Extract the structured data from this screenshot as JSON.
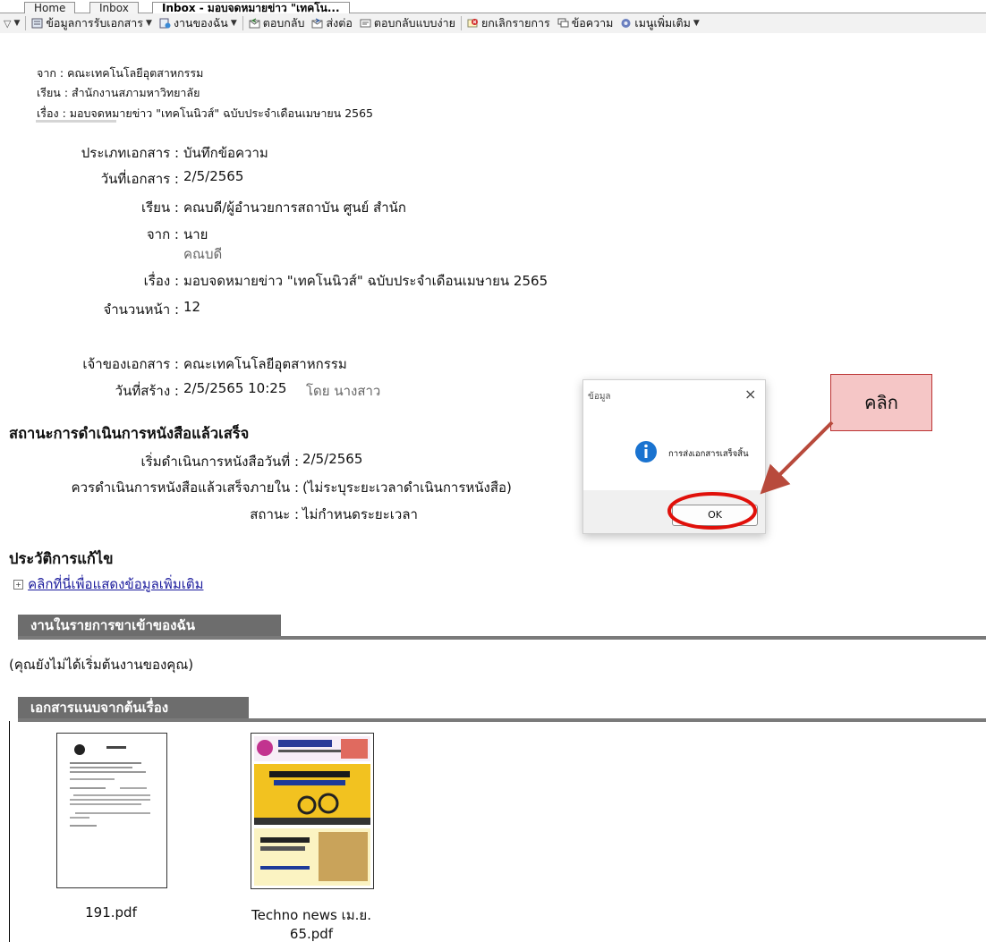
{
  "tabs": [
    {
      "label": "Home"
    },
    {
      "label": "Inbox"
    },
    {
      "label": "Inbox - มอบจดหมายข่าว \"เทคโน..."
    }
  ],
  "toolbar": {
    "doc_info": "ข้อมูลการรับเอกสาร",
    "my_work": "งานของฉัน",
    "reply": "ตอบกลับ",
    "forward": "ส่งต่อ",
    "simple_reply": "ตอบกลับแบบง่าย",
    "cancel_item": "ยกเลิกรายการ",
    "message": "ข้อความ",
    "more_menu": "เมนูเพิ่มเติม"
  },
  "header": {
    "from": "จาก : คณะเทคโนโลยีอุตสาหกรรม",
    "to": "เรียน : สำนักงานสภามหาวิทยาลัย",
    "subject": "เรื่อง : มอบจดหมายข่าว \"เทคโนนิวส์\" ฉบับประจำเดือนเมษายน 2565"
  },
  "doc": {
    "type_label": "ประเภทเอกสาร :",
    "type_value": "บันทึกข้อความ",
    "date_label": "วันที่เอกสาร :",
    "date_value": "2/5/2565",
    "to_label": "เรียน :",
    "to_value": "คณบดี/ผู้อำนวยการสถาบัน ศูนย์ สำนัก",
    "from_label": "จาก :",
    "from_value": "นาย",
    "from_sub": "คณบดี",
    "subject_label": "เรื่อง :",
    "subject_value": "มอบจดหมายข่าว \"เทคโนนิวส์\" ฉบับประจำเดือนเมษายน 2565",
    "pages_label": "จำนวนหน้า :",
    "pages_value": "12",
    "owner_label": "เจ้าของเอกสาร :",
    "owner_value": "คณะเทคโนโลยีอุตสาหกรรม",
    "created_label": "วันที่สร้าง :",
    "created_value": "2/5/2565 10:25",
    "created_by": "โดย นางสาว"
  },
  "status": {
    "title": "สถานะการดำเนินการหนังสือแล้วเสร็จ",
    "start_label": "เริ่มดำเนินการหนังสือวันที่ :",
    "start_value": "2/5/2565",
    "due_label": "ควรดำเนินการหนังสือแล้วเสร็จภายใน :",
    "due_value": "(ไม่ระบุระยะเวลาดำเนินการหนังสือ)",
    "state_label": "สถานะ :",
    "state_value": "ไม่กำหนดระยะเวลา"
  },
  "history": {
    "title": "ประวัติการแก้ไข",
    "link": "คลิกที่นี่เพื่อแสดงข้อมูลเพิ่มเติม"
  },
  "work_section": {
    "title": "งานในรายการขาเข้าของฉัน",
    "note": "(คุณยังไม่ได้เริ่มต้นงานของคุณ)"
  },
  "attachments": {
    "title": "เอกสารแนบจากต้นเรื่อง",
    "files": [
      {
        "name": "191.pdf"
      },
      {
        "name_line1": "Techno news เม.ย.",
        "name_line2": "65.pdf"
      }
    ]
  },
  "dialog": {
    "title": "ข้อมูล",
    "message": "การส่งเอกสารเสร็จสิ้น",
    "ok": "OK"
  },
  "annotation": {
    "callout": "คลิก"
  }
}
